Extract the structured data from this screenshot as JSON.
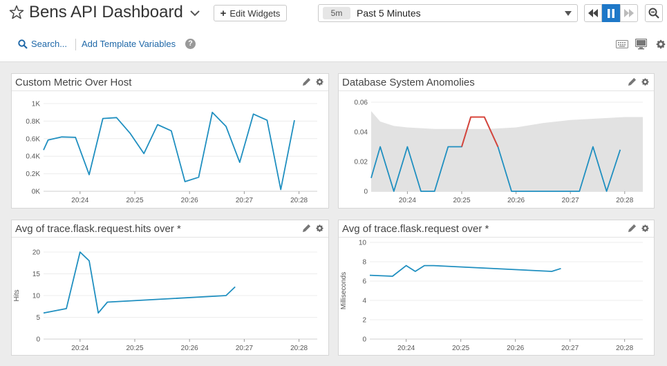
{
  "header": {
    "title": "Bens API Dashboard",
    "edit_widgets_label": "Edit Widgets",
    "time_abbr": "5m",
    "time_label": "Past 5 Minutes"
  },
  "subbar": {
    "search_label": "Search...",
    "template_vars_label": "Add Template Variables",
    "help_glyph": "?"
  },
  "icons": {
    "star": "star-icon",
    "caret": "chevron-down-icon",
    "plus": "plus-icon",
    "rewind": "rewind-icon",
    "pause": "pause-icon",
    "fast_forward": "fast-forward-icon",
    "zoom_out": "zoom-out-icon",
    "search": "search-icon",
    "help": "help-icon",
    "keyboard": "keyboard-icon",
    "tv_mode": "tv-icon",
    "settings": "gear-icon",
    "edit": "pencil-icon"
  },
  "colors": {
    "accent": "#1e78c8",
    "link": "#1f68a8",
    "series": "#1f8fc0",
    "anomaly_band": "#e2e2e2",
    "anomaly_line": "#d9443a"
  },
  "widgets": [
    {
      "title": "Custom Metric Over Host",
      "chart_data": {
        "type": "line",
        "title": "Custom Metric Over Host",
        "xlabel": "",
        "ylabel": "",
        "x_ticks": [
          "20:24",
          "20:25",
          "20:26",
          "20:27",
          "20:28"
        ],
        "y_ticks": [
          "0K",
          "0.2K",
          "0.4K",
          "0.6K",
          "0.8K",
          "1K"
        ],
        "ylim": [
          0,
          1000
        ],
        "xlim": [
          "20:23:20",
          "20:28:20"
        ],
        "grid": true,
        "series": [
          {
            "x": [
              "20:23:20",
              "20:23:25",
              "20:23:40",
              "20:23:55",
              "20:24:10",
              "20:24:25",
              "20:24:40",
              "20:24:55",
              "20:25:10",
              "20:25:25",
              "20:25:40",
              "20:25:55",
              "20:26:10",
              "20:26:25",
              "20:26:40",
              "20:26:55",
              "20:27:10",
              "20:27:25",
              "20:27:40",
              "20:27:55"
            ],
            "values": [
              470,
              585,
              620,
              615,
              190,
              830,
              840,
              660,
              430,
              760,
              690,
              110,
              160,
              900,
              740,
              330,
              880,
              810,
              20,
              810
            ]
          }
        ]
      }
    },
    {
      "title": "Database System Anomolies",
      "chart_data": {
        "type": "area",
        "title": "Database System Anomolies",
        "xlabel": "",
        "ylabel": "",
        "x_ticks": [
          "20:24",
          "20:25",
          "20:26",
          "20:27",
          "20:28"
        ],
        "y_ticks": [
          "0",
          "0.02",
          "0.04",
          "0.06"
        ],
        "ylim": [
          0,
          0.06
        ],
        "xlim": [
          "20:23:20",
          "20:28:20"
        ],
        "grid": true,
        "band": {
          "name": "expected range",
          "x": [
            "20:23:20",
            "20:23:30",
            "20:23:45",
            "20:24:00",
            "20:24:30",
            "20:25:00",
            "20:25:30",
            "20:26:00",
            "20:26:30",
            "20:27:00",
            "20:27:30",
            "20:28:00",
            "20:28:20"
          ],
          "upper": [
            0.054,
            0.047,
            0.044,
            0.043,
            0.042,
            0.042,
            0.042,
            0.043,
            0.046,
            0.048,
            0.049,
            0.05,
            0.05
          ],
          "lower": [
            0,
            0,
            0,
            0,
            0,
            0,
            0,
            0,
            0,
            0,
            0,
            0,
            0
          ]
        },
        "series": [
          {
            "x": [
              "20:23:20",
              "20:23:30",
              "20:23:45",
              "20:24:00",
              "20:24:15",
              "20:24:30",
              "20:24:45",
              "20:25:00",
              "20:25:10",
              "20:25:25",
              "20:25:40",
              "20:25:55",
              "20:26:10",
              "20:26:30",
              "20:26:50",
              "20:27:10",
              "20:27:25",
              "20:27:40",
              "20:27:55"
            ],
            "values": [
              0.009,
              0.03,
              0,
              0.03,
              0,
              0,
              0.03,
              0.03,
              0.05,
              0.05,
              0.03,
              0,
              0,
              0,
              0,
              0,
              0.03,
              0,
              0.028
            ],
            "anomalous_range": [
              "20:25:00",
              "20:25:40"
            ]
          }
        ]
      }
    },
    {
      "title": "Avg of trace.flask.request.hits over *",
      "chart_data": {
        "type": "line",
        "title": "Avg of trace.flask.request.hits over *",
        "xlabel": "",
        "ylabel": "Hits",
        "x_ticks": [
          "20:24",
          "20:25",
          "20:26",
          "20:27",
          "20:28"
        ],
        "y_ticks": [
          "0",
          "5",
          "10",
          "15",
          "20"
        ],
        "ylim": [
          0,
          20
        ],
        "xlim": [
          "20:23:20",
          "20:28:20"
        ],
        "grid": true,
        "series": [
          {
            "x": [
              "20:23:20",
              "20:23:45",
              "20:24:00",
              "20:24:10",
              "20:24:20",
              "20:24:30",
              "20:26:40",
              "20:26:50"
            ],
            "values": [
              6,
              7,
              20,
              18,
              6,
              8.5,
              10,
              12
            ]
          }
        ]
      }
    },
    {
      "title": "Avg of trace.flask.request over *",
      "chart_data": {
        "type": "line",
        "title": "Avg of trace.flask.request over *",
        "xlabel": "",
        "ylabel": "Milliseconds",
        "x_ticks": [
          "20:24",
          "20:25",
          "20:26",
          "20:27",
          "20:28"
        ],
        "y_ticks": [
          "0",
          "2",
          "4",
          "6",
          "8",
          "10"
        ],
        "ylim": [
          0,
          10
        ],
        "xlim": [
          "20:23:20",
          "20:28:20"
        ],
        "grid": true,
        "series": [
          {
            "x": [
              "20:23:20",
              "20:23:45",
              "20:24:00",
              "20:24:10",
              "20:24:20",
              "20:24:30",
              "20:26:40",
              "20:26:50"
            ],
            "values": [
              6.6,
              6.5,
              7.6,
              7.0,
              7.6,
              7.6,
              7.0,
              7.3
            ]
          }
        ]
      }
    }
  ]
}
